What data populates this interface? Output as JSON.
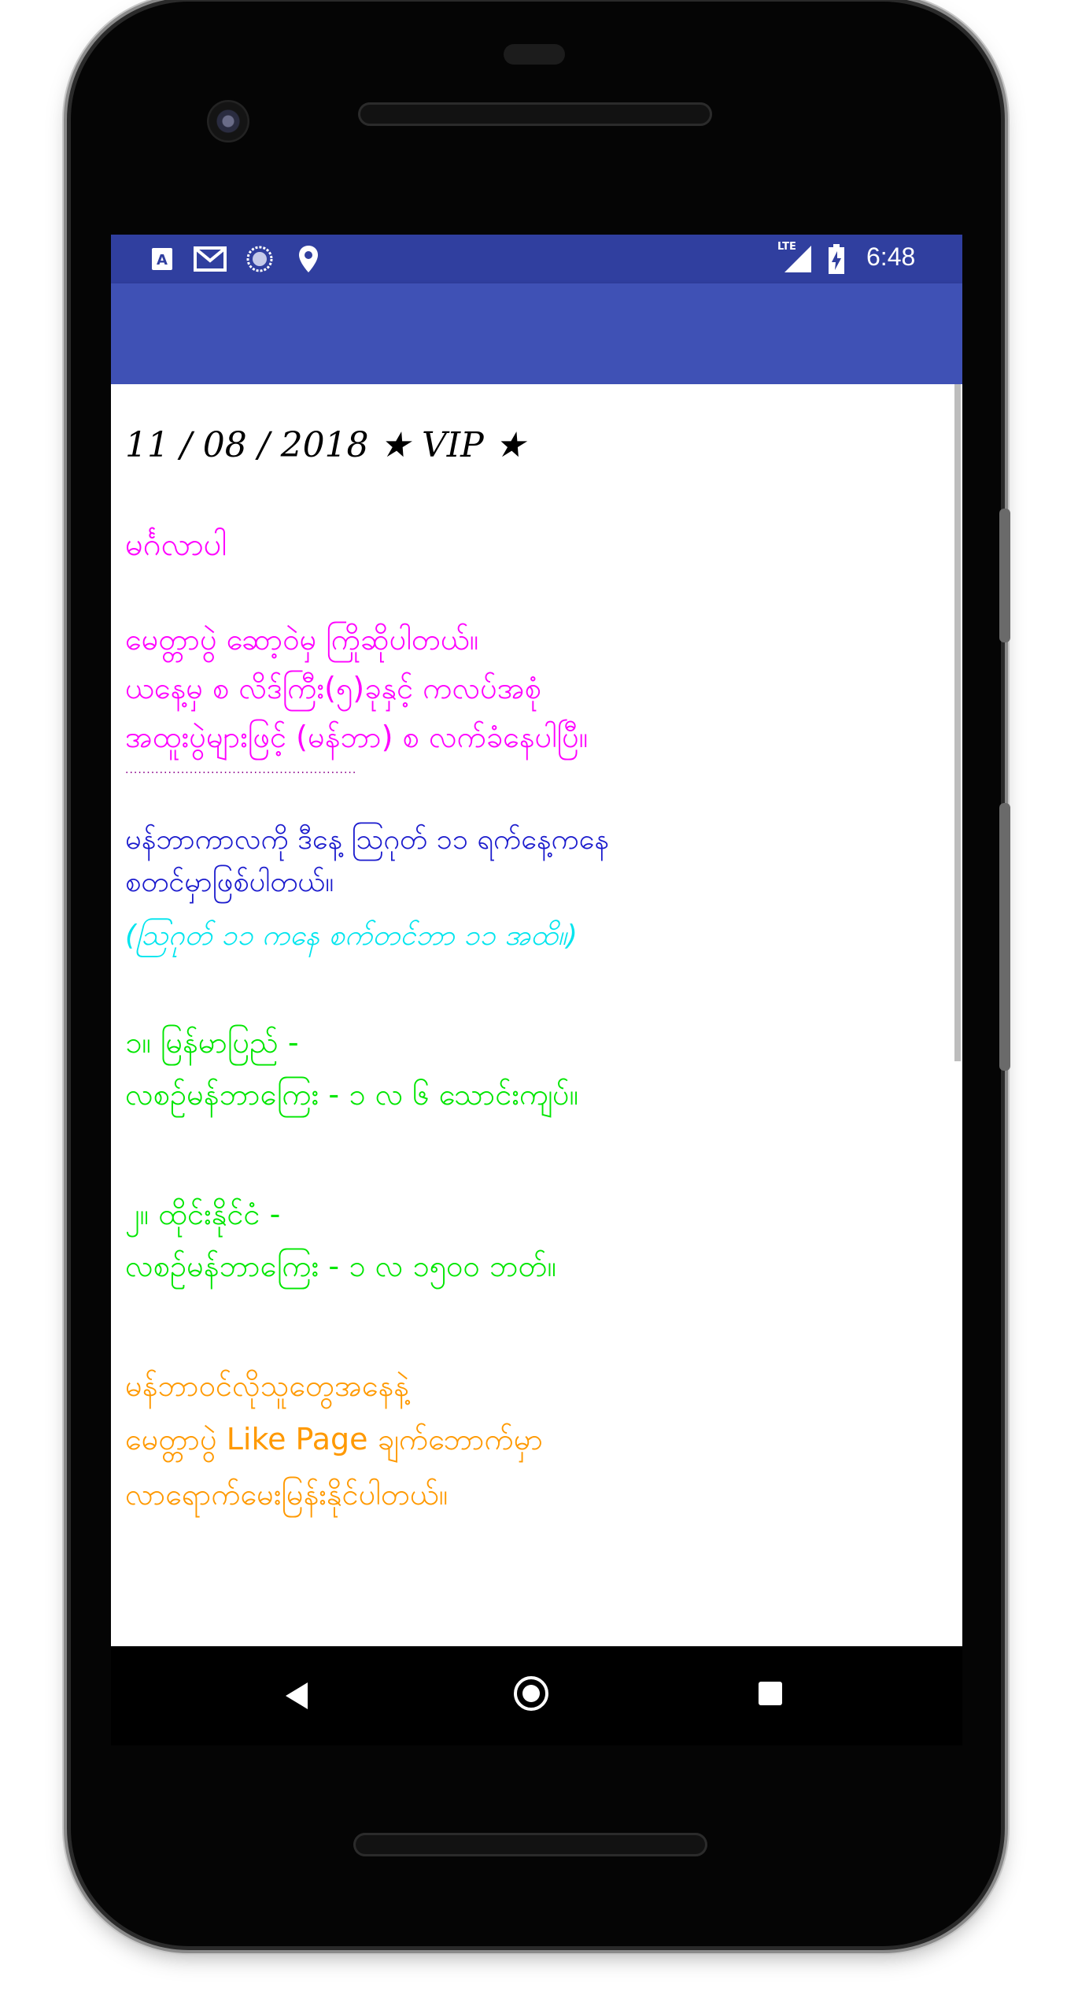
{
  "status_bar": {
    "time": "6:48",
    "network_label": "LTE",
    "icons": [
      "font-a-icon",
      "gmail-icon",
      "sync-circle-icon",
      "location-pin-icon",
      "signal-icon",
      "battery-charging-icon"
    ]
  },
  "content": {
    "title": "11 / 08 / 2018 ★ VIP ★",
    "greeting": "မင်္ဂလာပါ",
    "intro_lines": [
      "မေတ္တာပွဲ ဆော့ဝဲမှ ကြိုဆိုပါတယ်။",
      "ယနေ့မှ စ လိဒ်ကြီး(၅)ခုနှင့် ကလပ်အစုံ",
      "အထူးပွဲများဖြင့် (မန်ဘာ) စ လက်ခံနေပါပြီ။"
    ],
    "divider": "......................................................",
    "member_lines": [
      "မန်ဘာကာလကို ဒီနေ့ သြဂုတ် ၁၁ ရက်နေ့ကနေ",
      "စတင်မှာဖြစ်ပါတယ်။"
    ],
    "period_note": "(သြဂုတ် ၁၁ ကနေ စက်တင်ဘာ ၁၁ အထိ။)",
    "myanmar_heading": "၁။ မြန်မာပြည် -",
    "myanmar_fee": "လစဉ်မန်ဘာကြေး - ၁ လ ၆ သောင်းကျပ်။",
    "thailand_heading": "၂။ ထိုင်းနိုင်ငံ -",
    "thailand_fee": "လစဉ်မန်ဘာကြေး - ၁ လ ၁၅၀၀ ဘတ်။",
    "contact_lines": [
      "မန်ဘာဝင်လိုသူတွေအနေနဲ့",
      "မေတ္တာပွဲ Like Page ချက်ဘောက်မှာ",
      "လာရောက်မေးမြန်းနိုင်ပါတယ်။"
    ]
  },
  "colors": {
    "status_bar": "#303f9f",
    "app_bar": "#3f51b5",
    "magenta_text": "#ff00ff",
    "purple_divider": "#8b008b",
    "blue_text": "#1a1acd",
    "cyan_text": "#00e5ee",
    "green_text": "#00e600",
    "orange_text": "#ff9900"
  },
  "nav_bar": {
    "icons": [
      "back-triangle-icon",
      "home-circle-icon",
      "recents-square-icon"
    ]
  }
}
